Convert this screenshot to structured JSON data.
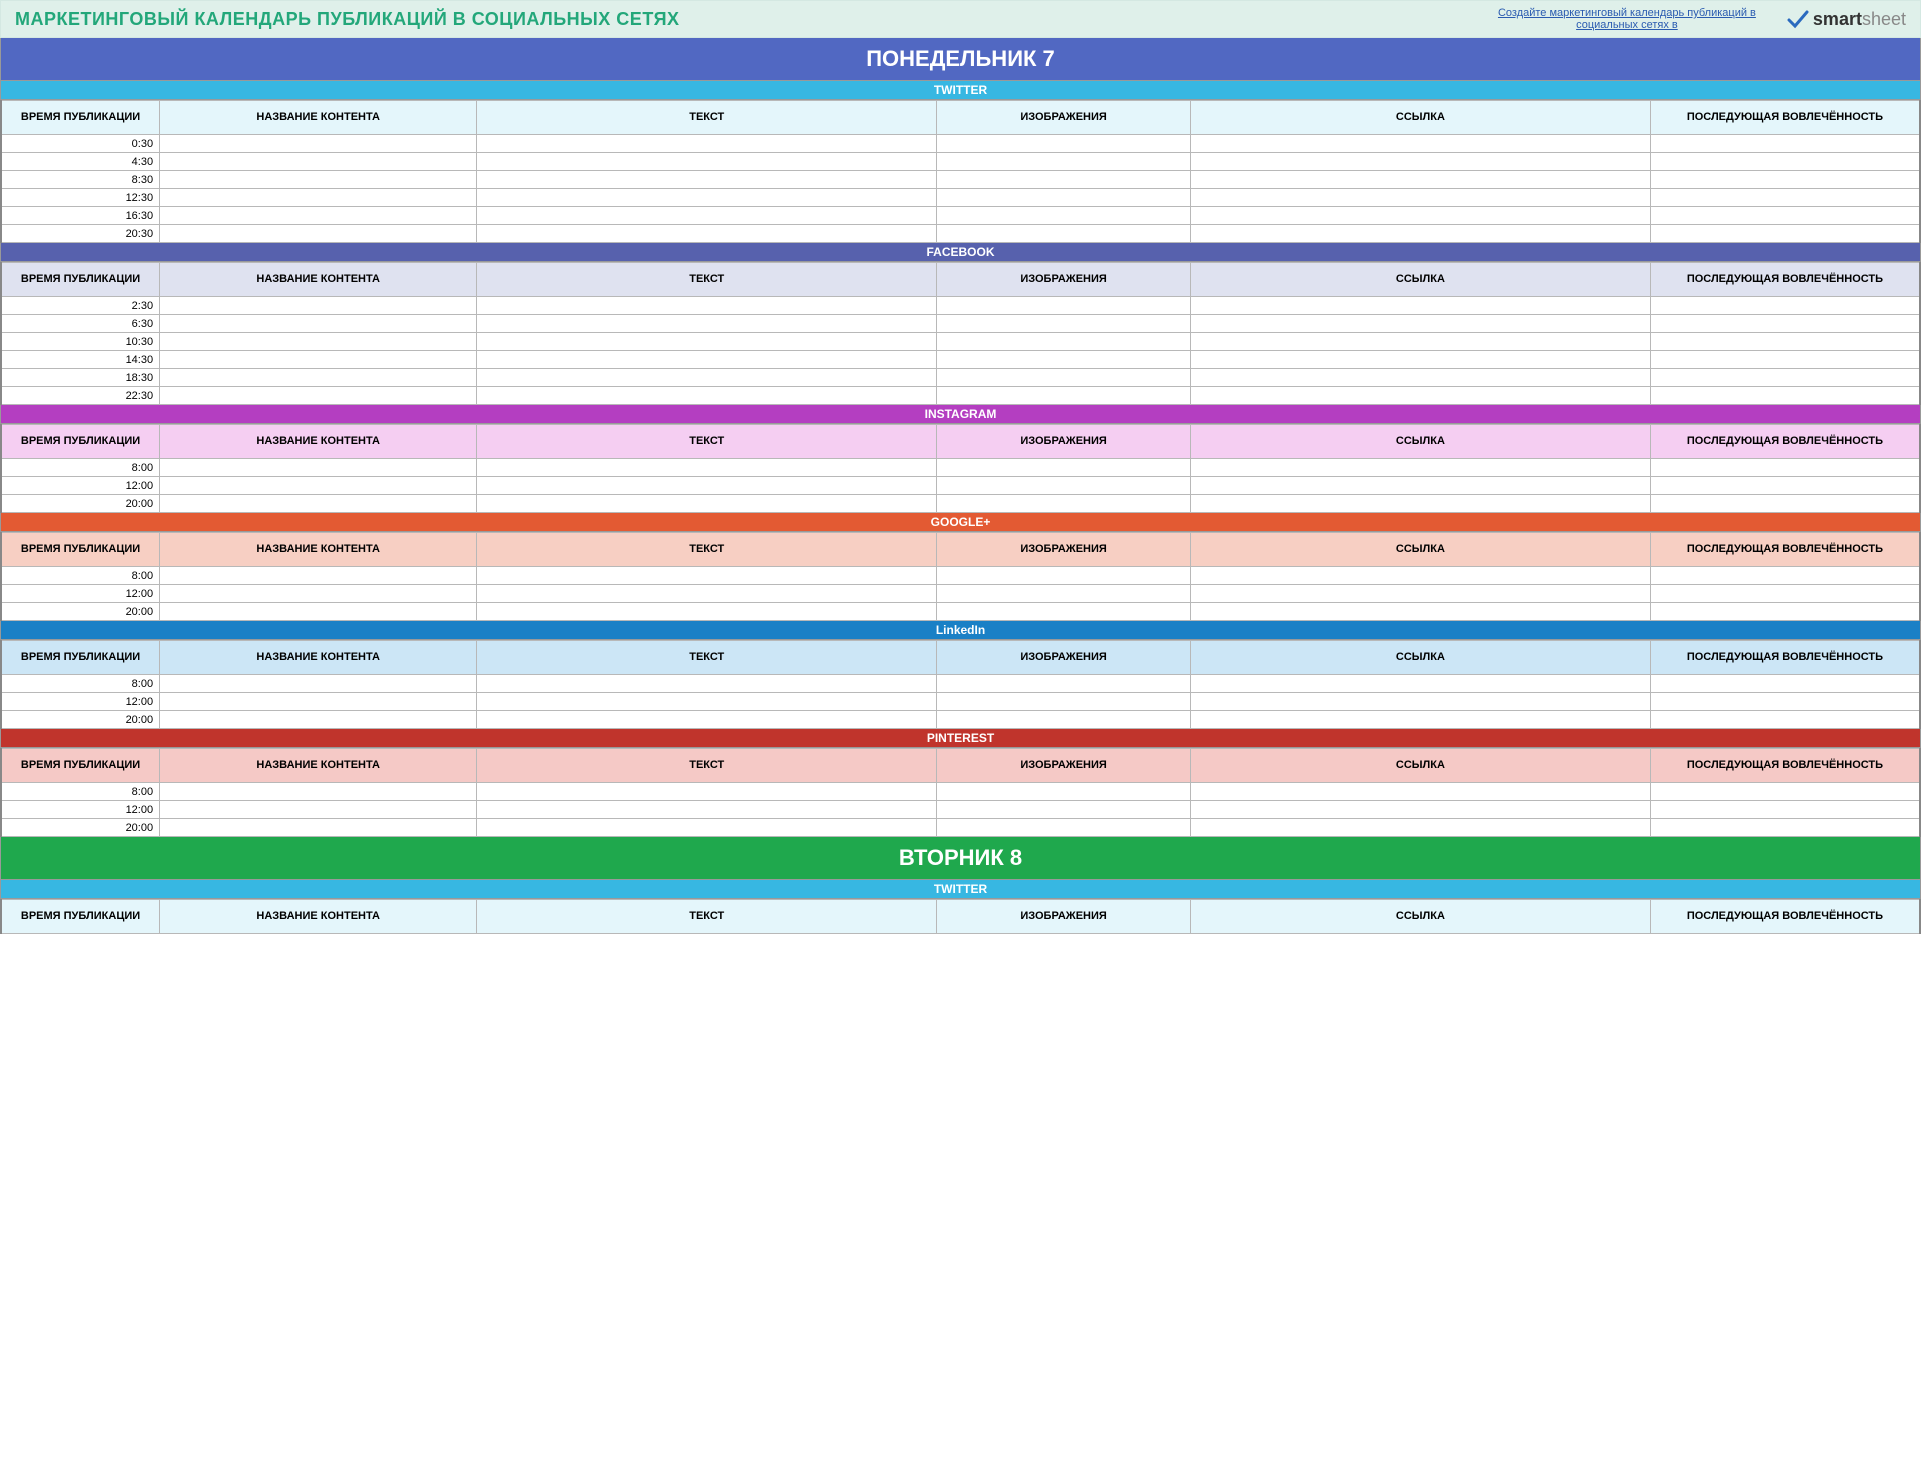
{
  "header": {
    "title": "МАРКЕТИНГОВЫЙ КАЛЕНДАРЬ ПУБЛИКАЦИЙ В СОЦИАЛЬНЫХ СЕТЯХ",
    "link_text": "Создайте маркетинговый календарь публикаций в социальных сетях в",
    "logo_bold": "smart",
    "logo_light": "sheet"
  },
  "columns": {
    "time": "ВРЕМЯ ПУБЛИКАЦИИ",
    "title": "НАЗВАНИЕ КОНТЕНТА",
    "text": "ТЕКСТ",
    "image": "ИЗОБРАЖЕНИЯ",
    "link": "ССЫЛКА",
    "engage": "ПОСЛЕДУЮЩАЯ ВОВЛЕЧЁННОСТЬ"
  },
  "days": [
    {
      "label": "ПОНЕДЕЛЬНИК   7",
      "class": "day-monday",
      "sections": [
        {
          "name": "TWITTER",
          "class": "section-twitter",
          "hdr": "hdr-twitter",
          "times": [
            "0:30",
            "4:30",
            "8:30",
            "12:30",
            "16:30",
            "20:30"
          ]
        },
        {
          "name": "FACEBOOK",
          "class": "section-facebook",
          "hdr": "hdr-facebook",
          "times": [
            "2:30",
            "6:30",
            "10:30",
            "14:30",
            "18:30",
            "22:30"
          ]
        },
        {
          "name": "INSTAGRAM",
          "class": "section-instagram",
          "hdr": "hdr-instagram",
          "times": [
            "8:00",
            "12:00",
            "20:00"
          ]
        },
        {
          "name": "GOOGLE+",
          "class": "section-google",
          "hdr": "hdr-google",
          "times": [
            "8:00",
            "12:00",
            "20:00"
          ]
        },
        {
          "name": "LinkedIn",
          "class": "section-linkedin",
          "hdr": "hdr-linkedin",
          "times": [
            "8:00",
            "12:00",
            "20:00"
          ]
        },
        {
          "name": "PINTEREST",
          "class": "section-pinterest",
          "hdr": "hdr-pinterest",
          "times": [
            "8:00",
            "12:00",
            "20:00"
          ]
        }
      ]
    },
    {
      "label": "ВТОРНИК   8",
      "class": "day-tuesday",
      "sections": [
        {
          "name": "TWITTER",
          "class": "section-twitter",
          "hdr": "hdr-twitter",
          "times": []
        }
      ]
    }
  ]
}
